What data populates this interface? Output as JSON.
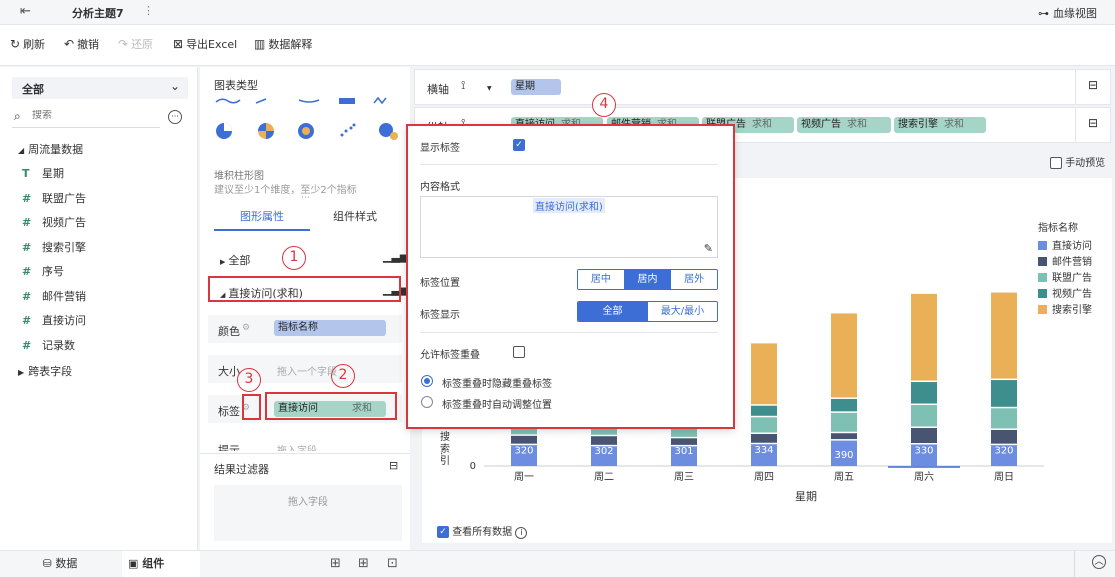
{
  "topbar": {
    "title": "分析主题7",
    "lineage": "血缘视图"
  },
  "toolbar": {
    "refresh": "刷新",
    "undo": "撤销",
    "redo": "还原",
    "export": "导出Excel",
    "explain": "数据解释"
  },
  "datasource": {
    "select": "全部",
    "search_placeholder": "搜索",
    "group": "周流量数据",
    "fields": [
      {
        "icon": "T",
        "label": "星期"
      },
      {
        "icon": "#",
        "label": "联盟广告"
      },
      {
        "icon": "#",
        "label": "视频广告"
      },
      {
        "icon": "#",
        "label": "搜索引擎"
      },
      {
        "icon": "#",
        "label": "序号"
      },
      {
        "icon": "#",
        "label": "邮件营销"
      },
      {
        "icon": "#",
        "label": "直接访问"
      },
      {
        "icon": "#",
        "label": "记录数"
      }
    ],
    "crosstab": "跨表字段"
  },
  "props": {
    "chart_type_title": "图表类型",
    "chart_name": "堆积柱形图",
    "chart_hint": "建议至少1个维度，至少2个指标",
    "tab_shape": "图形属性",
    "tab_style": "组件样式",
    "all": "全部",
    "measure": "直接访问(求和)",
    "color": "颜色",
    "color_pill": "指标名称",
    "size": "大小",
    "size_placeholder": "拖入一个字段",
    "label": "标签",
    "label_pill": "直接访问",
    "label_pill_agg": "求和",
    "tooltip": "提示",
    "tooltip_placeholder": "拖入字段",
    "filter_title": "结果过滤器",
    "filter_placeholder": "拖入字段"
  },
  "shelves": {
    "x_label": "横轴",
    "x_pill": "星期",
    "y_label": "纵轴",
    "y_pills": [
      {
        "name": "直接访问",
        "agg": "求和"
      },
      {
        "name": "邮件营销",
        "agg": "求和"
      },
      {
        "name": "联盟广告",
        "agg": "求和"
      },
      {
        "name": "视频广告",
        "agg": "求和"
      },
      {
        "name": "搜索引擎",
        "agg": "求和"
      }
    ]
  },
  "manual_preview": "手动预览",
  "view_all_data": "查看所有数据",
  "popup": {
    "show_label": "显示标签",
    "content_format": "内容格式",
    "content_token": "直接访问(求和)",
    "position_title": "标签位置",
    "positions": [
      "居中",
      "居内",
      "居外"
    ],
    "position_selected": "居内",
    "display_title": "标签显示",
    "displays": [
      "全部",
      "最大/最小"
    ],
    "display_selected": "全部",
    "allow_overlap": "允许标签重叠",
    "overlap_options": [
      "标签重叠时隐藏重叠标签",
      "标签重叠时自动调整位置"
    ]
  },
  "badges": [
    "1",
    "2",
    "3",
    "4"
  ],
  "bottom": {
    "data_tab": "数据",
    "component_tab": "组件"
  },
  "colors": {
    "direct": "#6d8de0",
    "email": "#475572",
    "union": "#7fc0b4",
    "video": "#3e8e8e",
    "search": "#e9b057",
    "accent": "#3c6ed5",
    "red": "#d9363e"
  },
  "chart_data": {
    "type": "bar",
    "stacked": true,
    "xlabel": "星期",
    "ylabel": "搜索引",
    "categories": [
      "周一",
      "周二",
      "周三",
      "周四",
      "周五",
      "周六",
      "周日"
    ],
    "legend_title": "指标名称",
    "series": [
      {
        "name": "直接访问",
        "color": "#6d8de0",
        "values": [
          320,
          302,
          301,
          334,
          390,
          330,
          320
        ],
        "labels": [
          "320",
          "302",
          "301",
          "334",
          "390",
          "330",
          "320"
        ]
      },
      {
        "name": "邮件营销",
        "color": "#475572",
        "values": [
          120,
          132,
          101,
          134,
          90,
          230,
          210
        ]
      },
      {
        "name": "联盟广告",
        "color": "#7fc0b4",
        "values": [
          220,
          182,
          191,
          234,
          290,
          330,
          310
        ]
      },
      {
        "name": "视频广告",
        "color": "#3e8e8e",
        "values": [
          150,
          212,
          201,
          154,
          190,
          330,
          410
        ]
      },
      {
        "name": "搜索引擎",
        "color": "#e9b057",
        "values": [
          820,
          832,
          901,
          934,
          1290,
          1330,
          1320
        ]
      }
    ],
    "ylim": [
      0,
      3500
    ],
    "y_ticks": [
      "0"
    ]
  }
}
